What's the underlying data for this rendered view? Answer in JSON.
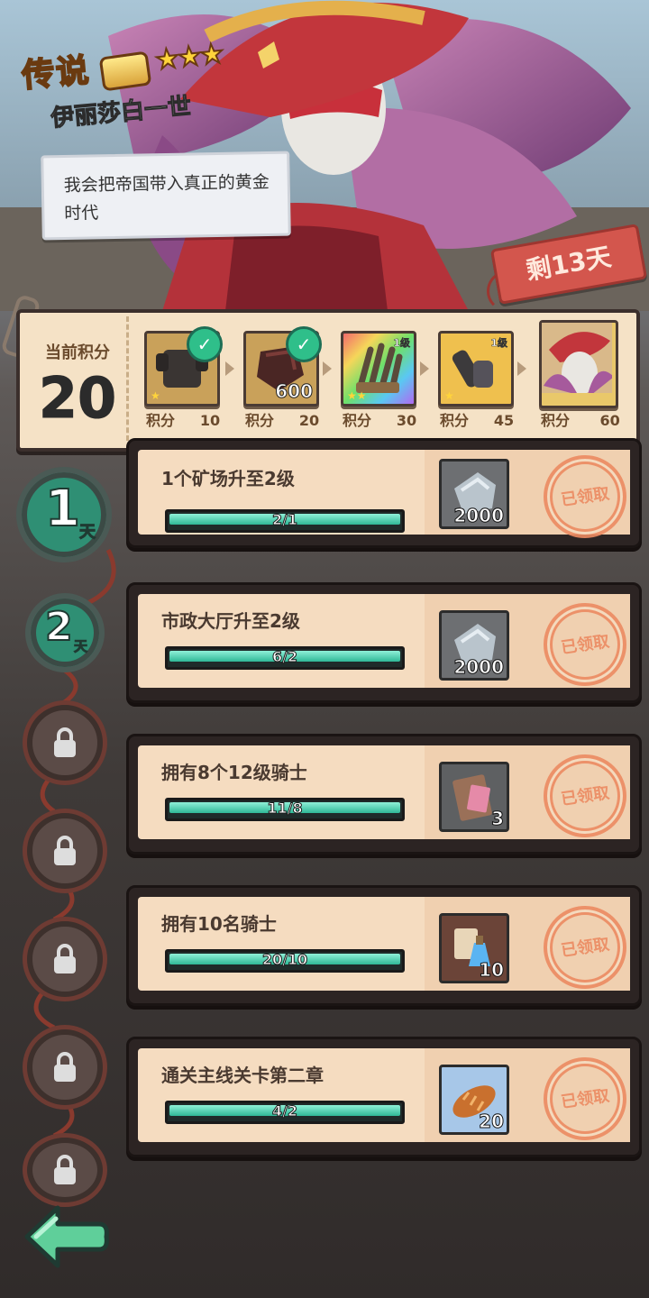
{
  "header": {
    "rarity": "传说",
    "stars": "★★★",
    "hero_name": "伊丽莎白一世",
    "quote": "我会把帝国带入真正的黄金时代",
    "days_left": "剩13天"
  },
  "score": {
    "label": "当前积分",
    "value": "20",
    "rewards": [
      {
        "icon": "armor-icon",
        "points_label": "积分",
        "points": "10",
        "claimed": true,
        "qty": "",
        "level": ""
      },
      {
        "icon": "ore-icon",
        "points_label": "积分",
        "points": "20",
        "claimed": true,
        "qty": "600",
        "level": ""
      },
      {
        "icon": "claw-weapon-icon",
        "points_label": "积分",
        "points": "30",
        "claimed": false,
        "qty": "",
        "level": "1级"
      },
      {
        "icon": "gauntlet-icon",
        "points_label": "积分",
        "points": "45",
        "claimed": false,
        "qty": "",
        "level": "1级"
      },
      {
        "icon": "hero-portrait-icon",
        "points_label": "积分",
        "points": "60",
        "claimed": false,
        "qty": "",
        "level": ""
      }
    ]
  },
  "days": [
    {
      "num": "1",
      "unit": "天",
      "state": "active"
    },
    {
      "num": "2",
      "unit": "天",
      "state": "active"
    },
    {
      "state": "locked"
    },
    {
      "state": "locked"
    },
    {
      "state": "locked"
    },
    {
      "state": "locked"
    },
    {
      "state": "locked"
    }
  ],
  "tasks": [
    {
      "title": "1个矿场升至2级",
      "progress_text": "2/1",
      "progress": 1.0,
      "reward_icon": "stone-icon",
      "reward_qty": "2000",
      "status": "已领取"
    },
    {
      "title": "市政大厅升至2级",
      "progress_text": "6/2",
      "progress": 1.0,
      "reward_icon": "stone-icon",
      "reward_qty": "2000",
      "status": "已领取"
    },
    {
      "title": "拥有8个12级骑士",
      "progress_text": "11/8",
      "progress": 1.0,
      "reward_icon": "scroll-icon",
      "reward_qty": "3",
      "status": "已领取"
    },
    {
      "title": "拥有10名骑士",
      "progress_text": "20/10",
      "progress": 1.0,
      "reward_icon": "potion-icon",
      "reward_qty": "10",
      "status": "已领取"
    },
    {
      "title": "通关主线关卡第二章",
      "progress_text": "4/2",
      "progress": 1.0,
      "reward_icon": "bread-icon",
      "reward_qty": "20",
      "status": "已领取"
    }
  ]
}
